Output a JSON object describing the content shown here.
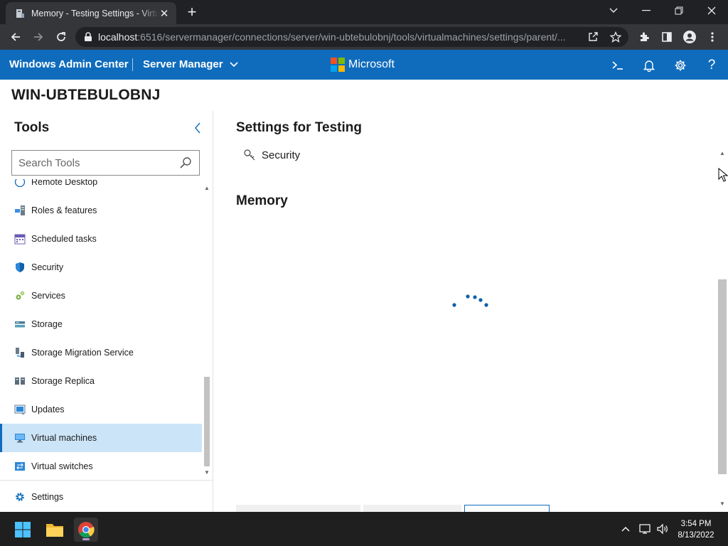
{
  "browser": {
    "tab_title": "Memory - Testing Settings - Virtu",
    "url_host": "localhost",
    "url_rest": ":6516/servermanager/connections/server/win-ubtebulobnj/tools/virtualmachines/settings/parent/..."
  },
  "header": {
    "app_title": "Windows Admin Center",
    "context_menu_label": "Server Manager",
    "brand": "Microsoft",
    "brand_colors": [
      "#f25022",
      "#7fba00",
      "#00a4ef",
      "#ffb900"
    ]
  },
  "server": {
    "name": "WIN-UBTEBULOBNJ"
  },
  "sidebar": {
    "title": "Tools",
    "search_placeholder": "Search Tools",
    "items": [
      {
        "label": "Remote Desktop",
        "icon": "remote-desktop-icon"
      },
      {
        "label": "Roles & features",
        "icon": "roles-features-icon"
      },
      {
        "label": "Scheduled tasks",
        "icon": "calendar-icon"
      },
      {
        "label": "Security",
        "icon": "shield-icon"
      },
      {
        "label": "Services",
        "icon": "gears-icon"
      },
      {
        "label": "Storage",
        "icon": "storage-icon"
      },
      {
        "label": "Storage Migration Service",
        "icon": "migration-icon"
      },
      {
        "label": "Storage Replica",
        "icon": "replica-icon"
      },
      {
        "label": "Updates",
        "icon": "updates-icon"
      },
      {
        "label": "Virtual machines",
        "icon": "virtual-machine-icon",
        "selected": true
      },
      {
        "label": "Virtual switches",
        "icon": "virtual-switch-icon"
      }
    ],
    "settings_label": "Settings"
  },
  "main": {
    "title": "Settings for Testing",
    "security_link": "Security",
    "section_title": "Memory"
  },
  "taskbar": {
    "time": "3:54 PM",
    "date": "8/13/2022"
  },
  "colors": {
    "accent": "#0f6cbd",
    "selected_bg": "#cce4f7",
    "spinner": "#0f5fa8"
  }
}
